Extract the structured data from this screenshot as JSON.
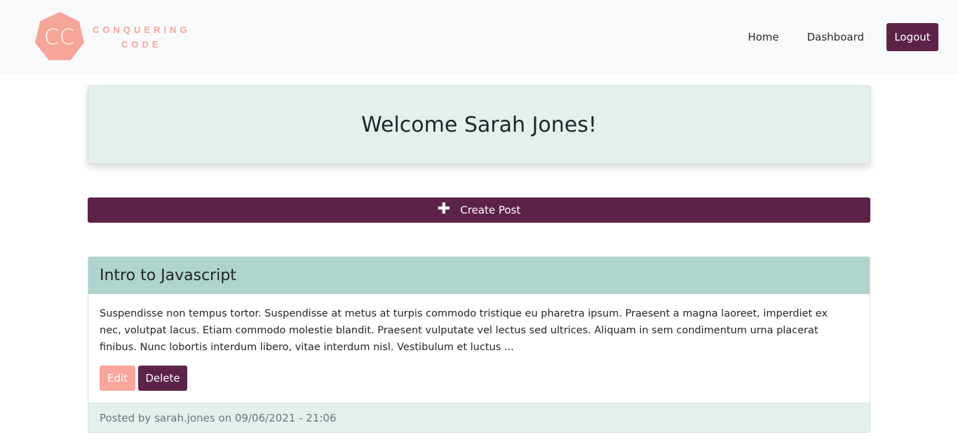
{
  "brand": {
    "badge_text": "CC",
    "line1": "CONQUERING",
    "line2": "CODE",
    "badge_color": "#f7a599"
  },
  "nav": {
    "home": "Home",
    "dashboard": "Dashboard",
    "logout": "Logout"
  },
  "welcome": {
    "title": "Welcome Sarah Jones!"
  },
  "create_post": {
    "label": "Create Post",
    "icon": "plus-icon"
  },
  "post": {
    "title": "Intro to Javascript",
    "body": "Suspendisse non tempus tortor. Suspendisse at metus at turpis commodo tristique eu pharetra ipsum. Praesent a magna laoreet, imperdiet ex nec, volutpat lacus. Etiam commodo molestie blandit. Praesent vulputate vel lectus sed ultrices. Aliquam in sem condimentum urna placerat finibus. Nunc lobortis interdum libero, vitae interdum nisl. Vestibulum et luctus ...",
    "edit_label": "Edit",
    "delete_label": "Delete",
    "footer_prefix": "Posted by",
    "author": "sarah.jones",
    "footer_on": "on",
    "date": "09/06/2021 - 21:06"
  },
  "colors": {
    "primary": "#5c2248",
    "accent": "#f9a195",
    "header_teal": "#aed4cd",
    "light_teal": "#e5f0ed"
  }
}
